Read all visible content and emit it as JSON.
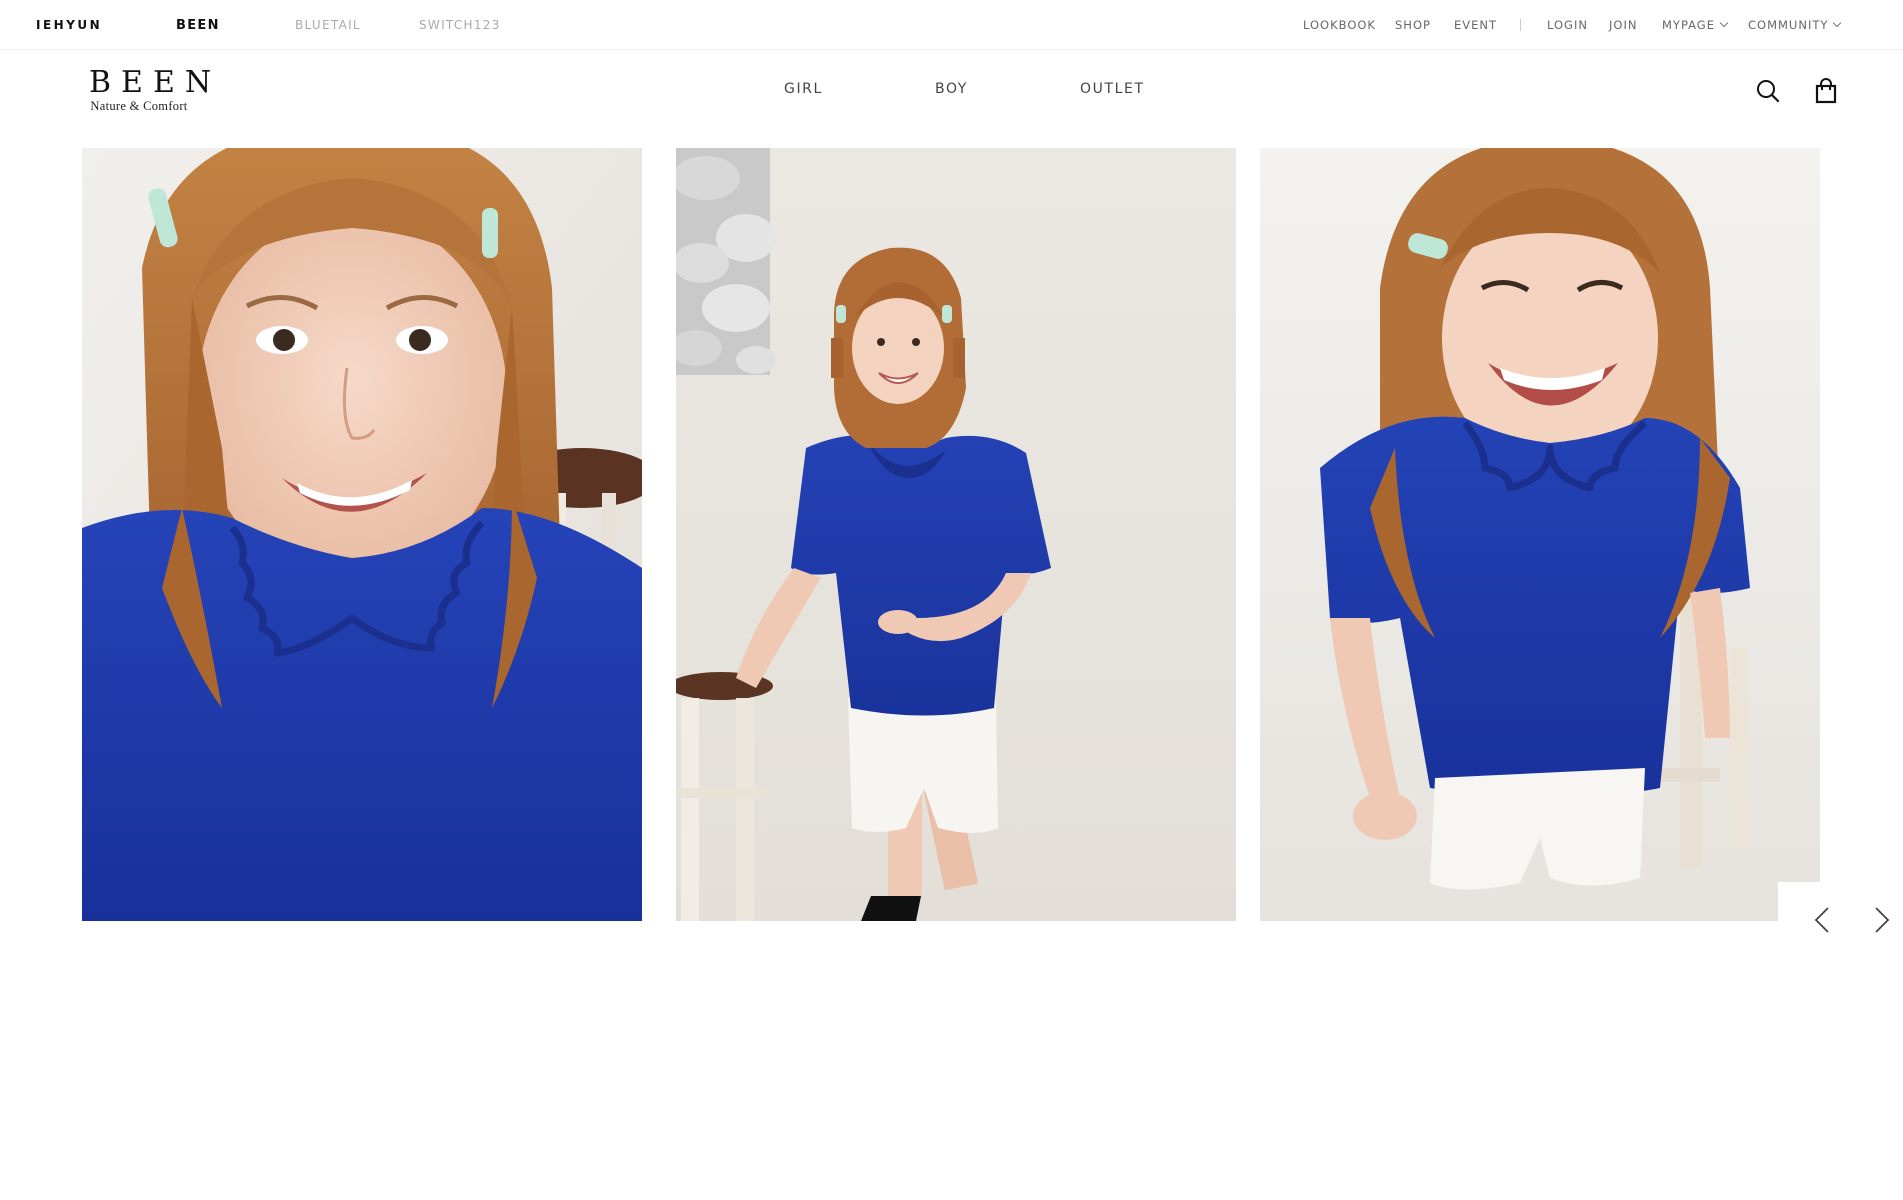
{
  "brand_tabs": [
    {
      "label": "IEHYUN",
      "active": false
    },
    {
      "label": "BEEN",
      "active": true
    },
    {
      "label": "BLUETAIL",
      "active": false
    },
    {
      "label": "SWITCH123",
      "active": false
    }
  ],
  "util_nav": {
    "lookbook": "LOOKBOOK",
    "shop": "SHOP",
    "event": "EVENT",
    "login": "LOGIN",
    "join": "JOIN",
    "mypage": "MYPAGE",
    "community": "COMMUNITY"
  },
  "logo": {
    "main": "BEEN",
    "sub": "Nature & Comfort"
  },
  "main_nav": [
    {
      "label": "GIRL"
    },
    {
      "label": "BOY"
    },
    {
      "label": "OUTLET"
    }
  ],
  "header_icons": {
    "search": "search-icon",
    "cart": "shopping-bag-icon"
  },
  "carousel": {
    "slides": [
      {
        "subject": "girl-close-up-blue-ruffle-collar-shirt"
      },
      {
        "subject": "girl-full-body-blue-shirt-white-shorts-stool"
      },
      {
        "subject": "girl-laughing-blue-shirt-white-shorts"
      }
    ],
    "prev_icon": "chevron-left-icon",
    "next_icon": "chevron-right-icon"
  },
  "colors": {
    "shirt_blue": "#1d3aa8",
    "hair": "#b8703a",
    "background_photo": "#ece9e4"
  }
}
